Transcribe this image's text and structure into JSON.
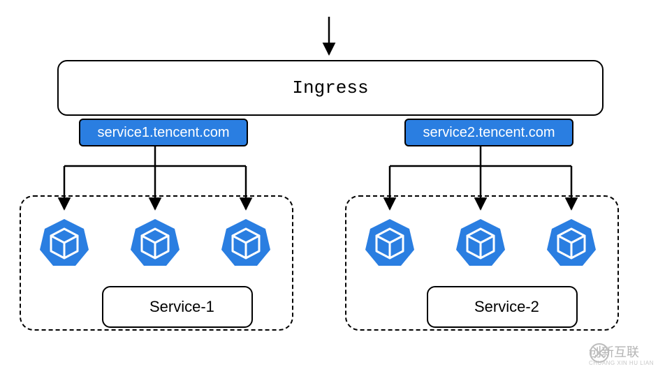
{
  "chart_data": {
    "type": "diagram",
    "title": "Ingress",
    "nodes": [
      {
        "id": "ingress",
        "label": "Ingress",
        "kind": "router"
      },
      {
        "id": "host1",
        "label": "service1.tencent.com",
        "kind": "host-rule",
        "parent": "ingress"
      },
      {
        "id": "host2",
        "label": "service2.tencent.com",
        "kind": "host-rule",
        "parent": "ingress"
      },
      {
        "id": "svc1",
        "label": "Service-1",
        "kind": "service"
      },
      {
        "id": "svc2",
        "label": "Service-2",
        "kind": "service"
      },
      {
        "id": "pod1a",
        "kind": "pod",
        "service": "svc1"
      },
      {
        "id": "pod1b",
        "kind": "pod",
        "service": "svc1"
      },
      {
        "id": "pod1c",
        "kind": "pod",
        "service": "svc1"
      },
      {
        "id": "pod2a",
        "kind": "pod",
        "service": "svc2"
      },
      {
        "id": "pod2b",
        "kind": "pod",
        "service": "svc2"
      },
      {
        "id": "pod2c",
        "kind": "pod",
        "service": "svc2"
      }
    ],
    "edges": [
      {
        "from": "external",
        "to": "ingress"
      },
      {
        "from": "host1",
        "to": "pod1a"
      },
      {
        "from": "host1",
        "to": "pod1b"
      },
      {
        "from": "host1",
        "to": "pod1c"
      },
      {
        "from": "host2",
        "to": "pod2a"
      },
      {
        "from": "host2",
        "to": "pod2b"
      },
      {
        "from": "host2",
        "to": "pod2c"
      }
    ]
  },
  "ingress_label": "Ingress",
  "hosts": {
    "h1": "service1.tencent.com",
    "h2": "service2.tencent.com"
  },
  "services": {
    "s1": "Service-1",
    "s2": "Service-2"
  },
  "watermark": {
    "brand": "创新互联",
    "sub": "CHUANG XIN HU LIAN"
  },
  "colors": {
    "accent": "#2a7ee1"
  }
}
